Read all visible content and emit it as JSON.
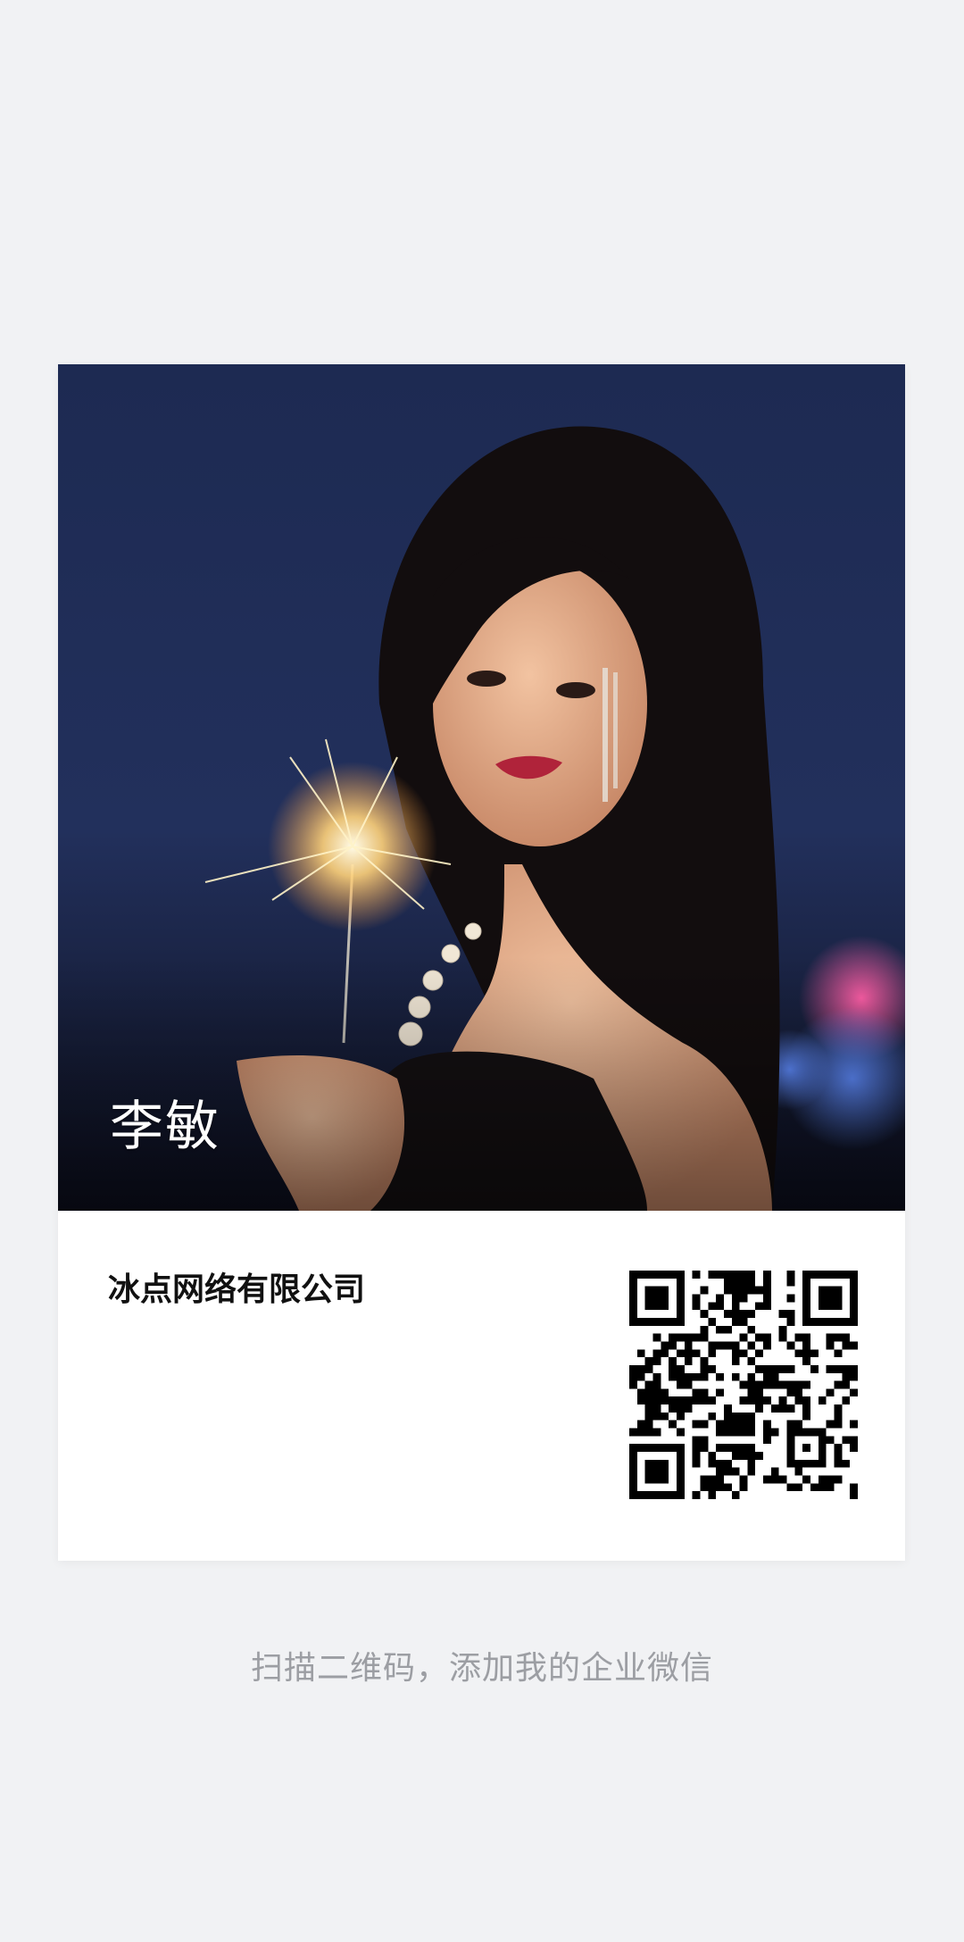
{
  "card": {
    "name": "李敏",
    "company": "冰点网络有限公司"
  },
  "caption": "扫描二维码，添加我的企业微信",
  "colors": {
    "background": "#f1f2f4",
    "card": "#ffffff",
    "caption_text": "#9c9ea3",
    "photo_sky": "#1e2c52"
  },
  "icons": {
    "qr": "qr-code-icon"
  }
}
